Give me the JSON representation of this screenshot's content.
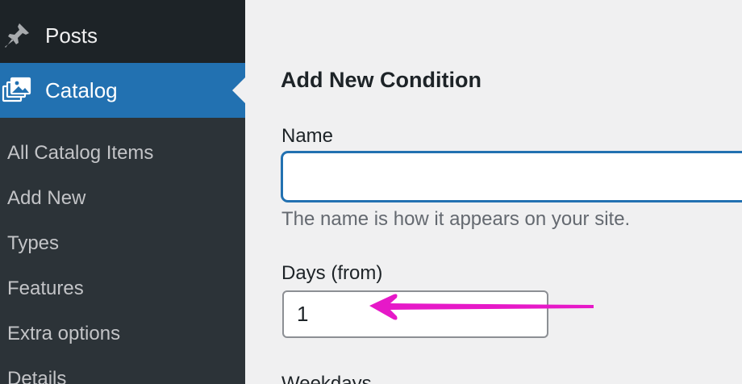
{
  "sidebar": {
    "posts": {
      "label": "Posts",
      "icon": "pin-icon"
    },
    "catalog": {
      "label": "Catalog",
      "icon": "catalog-images-icon",
      "active": true
    },
    "submenu": [
      {
        "label": "All Catalog Items"
      },
      {
        "label": "Add New"
      },
      {
        "label": "Types"
      },
      {
        "label": "Features"
      },
      {
        "label": "Extra options"
      },
      {
        "label": "Details"
      }
    ]
  },
  "form": {
    "heading": "Add New Condition",
    "name_label": "Name",
    "name_value": "",
    "name_hint": "The name is how it appears on your site.",
    "days_label": "Days (from)",
    "days_value": "1",
    "next_label": "Weekdays"
  },
  "annotation": {
    "arrow_color": "#e619c8"
  },
  "colors": {
    "sidebar_bg": "#2c3338",
    "active_bg": "#2271b1",
    "focus_border": "#2271b1",
    "page_bg": "#f0f0f1"
  }
}
